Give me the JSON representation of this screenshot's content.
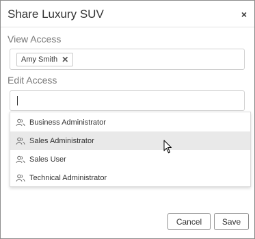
{
  "dialog": {
    "title": "Share Luxury SUV",
    "close_glyph": "×"
  },
  "view_access": {
    "label": "View Access",
    "chips": [
      {
        "label": "Amy Smith",
        "remove_glyph": "✕"
      }
    ]
  },
  "edit_access": {
    "label": "Edit Access",
    "input_value": ""
  },
  "dropdown": {
    "options": [
      {
        "label": "Business Administrator",
        "icon": "users-icon"
      },
      {
        "label": "Sales Administrator",
        "icon": "users-icon",
        "hovered": true
      },
      {
        "label": "Sales User",
        "icon": "users-icon"
      },
      {
        "label": "Technical Administrator",
        "icon": "users-icon"
      }
    ]
  },
  "footer": {
    "cancel_label": "Cancel",
    "save_label": "Save"
  }
}
